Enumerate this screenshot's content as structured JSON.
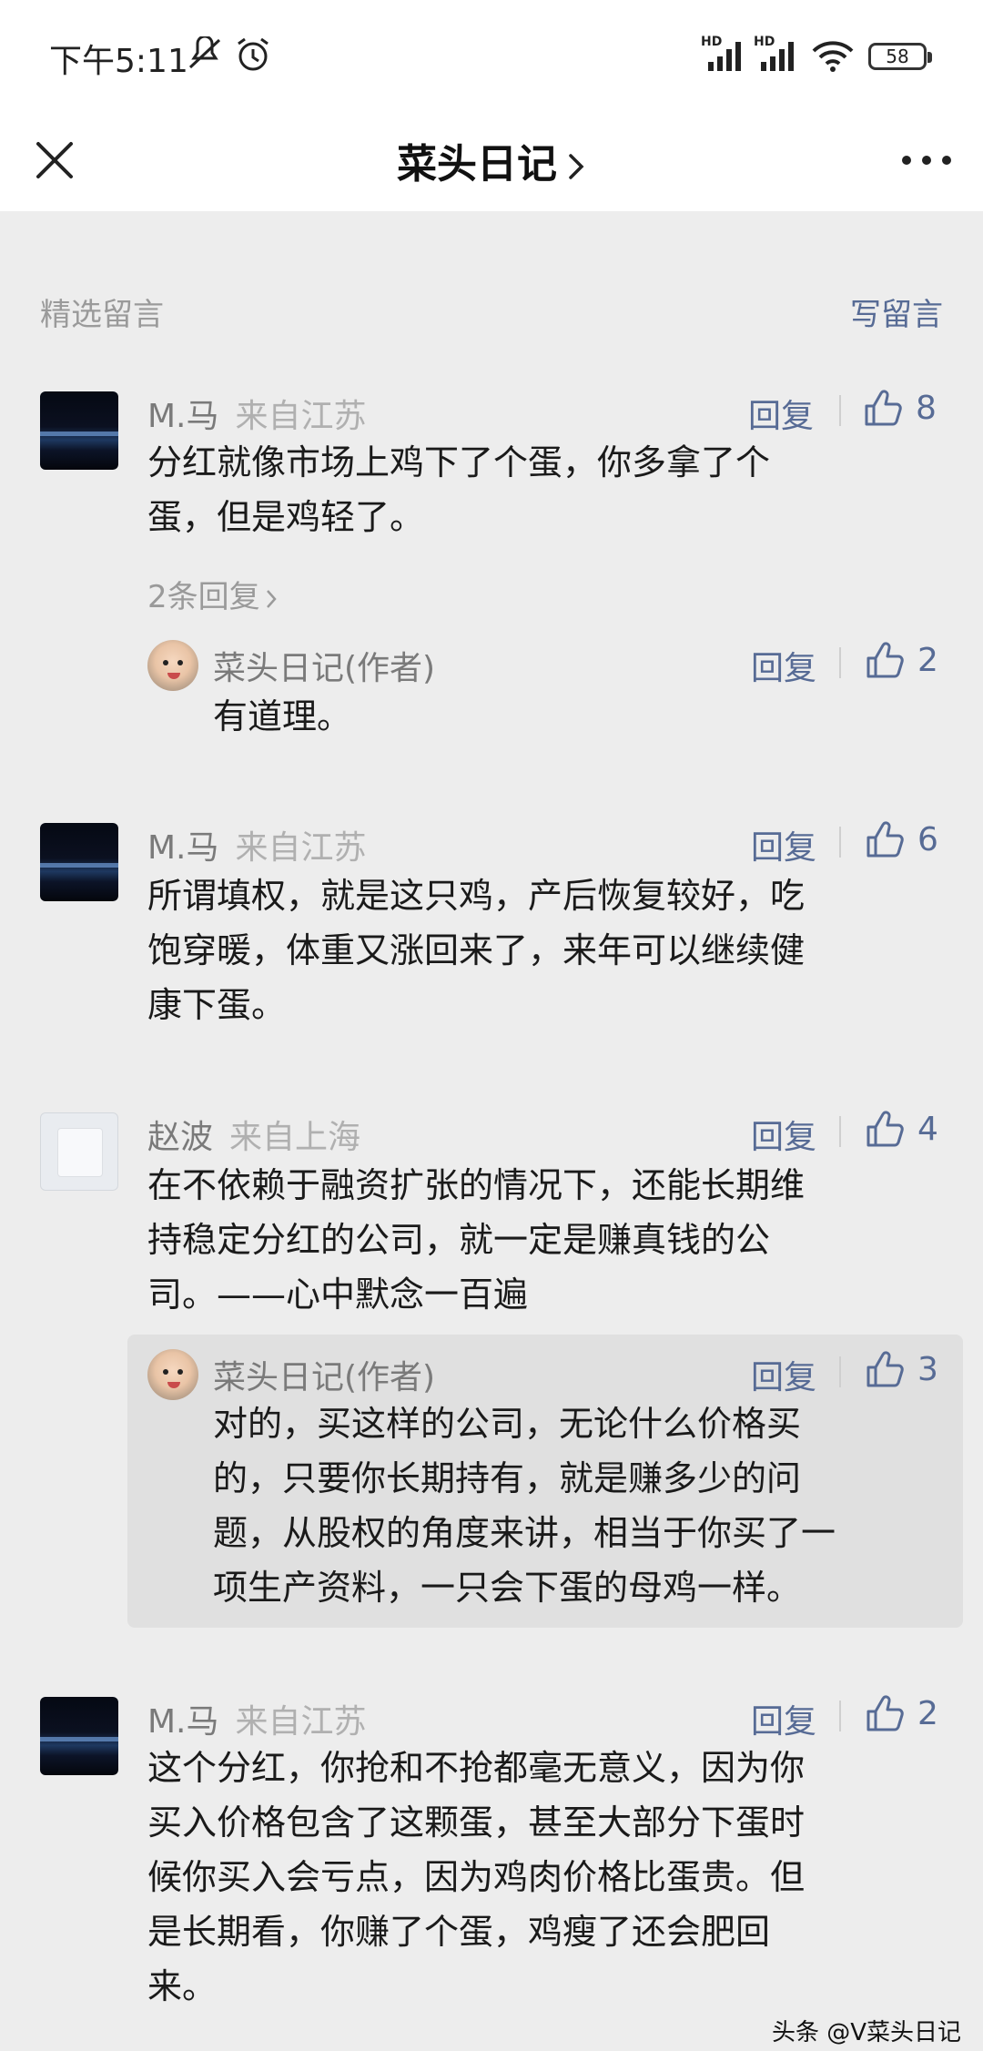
{
  "status_bar": {
    "time": "下午5:11",
    "battery": "58",
    "hd_label": "HD",
    "icons": [
      "mute-icon",
      "alarm-icon",
      "signal-icon",
      "signal-icon",
      "wifi-icon",
      "battery-icon"
    ]
  },
  "nav": {
    "title": "菜头日记",
    "icons": [
      "close-icon",
      "chevron-right-icon",
      "more-icon"
    ]
  },
  "section": {
    "title": "精选留言",
    "write_label": "写留言"
  },
  "reply_label": "回复",
  "comments": [
    {
      "name": "M.马",
      "location": "来自江苏",
      "likes": "8",
      "lines": [
        "分红就像市场上鸡下了个蛋，你多拿了个",
        "蛋，但是鸡轻了。"
      ],
      "more_replies": "2条回复",
      "reply": {
        "name": "菜头日记(作者)",
        "likes": "2",
        "lines": [
          "有道理。"
        ]
      }
    },
    {
      "name": "M.马",
      "location": "来自江苏",
      "likes": "6",
      "lines": [
        "所谓填权，就是这只鸡，产后恢复较好，吃",
        "饱穿暖，体重又涨回来了，来年可以继续健",
        "康下蛋。"
      ]
    },
    {
      "name": "赵波",
      "location": "来自上海",
      "likes": "4",
      "lines": [
        "在不依赖于融资扩张的情况下，还能长期维",
        "持稳定分红的公司，就一定是赚真钱的公",
        "司。——心中默念一百遍"
      ],
      "reply": {
        "name": "菜头日记(作者)",
        "likes": "3",
        "lines": [
          "对的，买这样的公司，无论什么价格买",
          "的，只要你长期持有，就是赚多少的问",
          "题，从股权的角度来讲，相当于你买了一",
          "项生产资料，一只会下蛋的母鸡一样。"
        ]
      }
    },
    {
      "name": "M.马",
      "location": "来自江苏",
      "likes": "2",
      "lines": [
        "这个分红，你抢和不抢都毫无意义，因为你",
        "买入价格包含了这颗蛋，甚至大部分下蛋时",
        "候你买入会亏点，因为鸡肉价格比蛋贵。但",
        "是长期看，你赚了个蛋，鸡瘦了还会肥回",
        "来。"
      ]
    }
  ],
  "watermark": "头条 @V菜头日记"
}
